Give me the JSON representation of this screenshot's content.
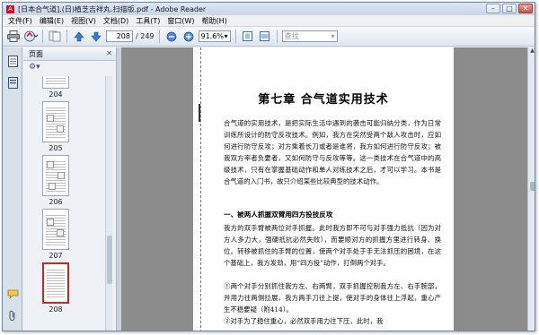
{
  "window": {
    "title": "[日本合气道].(日)植芝吉祥丸.扫描版.pdf - Adobe Reader",
    "controls": {
      "minimize": "–",
      "maximize": "□",
      "close": "✕"
    }
  },
  "menubar": {
    "items": [
      "文件(F)",
      "编辑(E)",
      "视图(V)",
      "文档(D)",
      "工具(T)",
      "窗口(W)",
      "帮助(H)"
    ]
  },
  "toolbar": {
    "page_current": "208",
    "page_total": "/ 249",
    "zoom": "91.6%",
    "find_placeholder": "查找"
  },
  "panel": {
    "title": "页面",
    "close": "✕",
    "options_icon": "⚙▾",
    "thumbnails": [
      {
        "label": "204",
        "selected": false
      },
      {
        "label": "205",
        "selected": false
      },
      {
        "label": "206",
        "selected": false
      },
      {
        "label": "207",
        "selected": false
      },
      {
        "label": "208",
        "selected": true
      }
    ]
  },
  "document": {
    "chapter_title": "第七章   合气道实用技术",
    "intro": "合气道的实用技术，是把实际生活中遇到的袭击可能归纳分类，作为日常训练所设计的防守反攻技术。例如，我方在突然受两个敌人攻击时，应如何进行防守反攻；对方乘着长刀或者是谁将，我方如何进行防守反攻；被我双方率者负要者，又如何防守与反攻等等。这一类技术在合气道中的高级技术，只有在掌握基础动作和单人对练技术之后，才可以学习。本书是合气道的入门书，故只介绍某些比较典型的技术动作。",
    "section_title": "一、被两人抓握双臂用四方投技反攻",
    "section_text": "我方的双手臂被两位对手抓握。此时我方即不可与对手强力抵抗（因为对方人多力大，强硬抵抗必然失败），而要顺对方的抓握方里进行转身、换位。转移被抓住的手臂的位置，使两个对手处于手无法抓压的困境，在这个基础上，我方发劲，用“四方投”动作，打倒两个对手。",
    "step1": "①两个对手分别抓住我方左、右两臂，双手抓握控制我方左、右手腕部，并用力往两侧拉展，我方两手刀往上提，使对手的身体往上浮起，重心产生不稳要疑（附414）。",
    "step2": "②对手为了稳住重心，必然双手用力往下压，此时，我"
  },
  "icons": {
    "app": "adobe-reader-icon",
    "print": "printer-icon",
    "email": "email-icon",
    "pages": "pages-icon",
    "prev": "up-arrow-icon",
    "next": "down-arrow-icon",
    "zoom_out": "zoom-out-icon",
    "zoom_in": "zoom-in-icon",
    "fit_page": "fit-page-icon",
    "fit_width": "fit-width-icon",
    "comments": "comment-icon",
    "attachments": "paperclip-icon"
  }
}
